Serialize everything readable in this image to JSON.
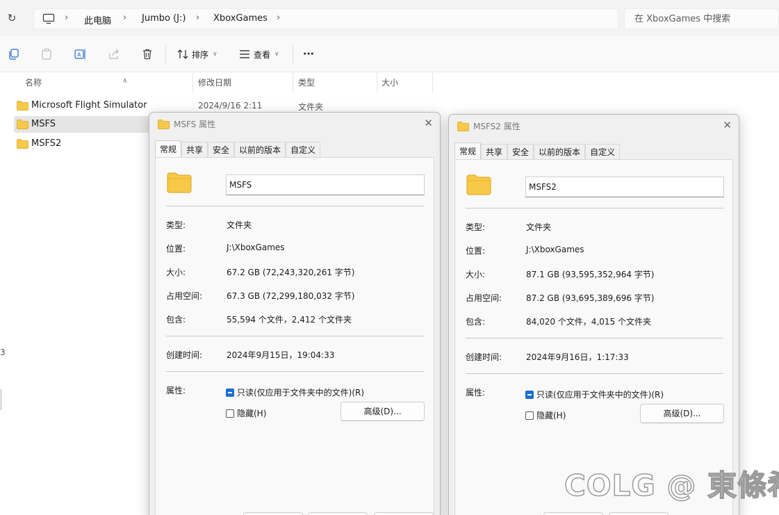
{
  "addressbar": {
    "crumbs": [
      "此电脑",
      "Jumbo (J:)",
      "XboxGames"
    ],
    "search_placeholder": "在 XboxGames 中搜索"
  },
  "toolbar": {
    "sort_label": "排序",
    "view_label": "查看",
    "more_label": "···"
  },
  "columns": {
    "name": "名称",
    "modified": "修改日期",
    "type": "类型",
    "size": "大小"
  },
  "files": [
    {
      "name": "Microsoft Flight Simulator",
      "modified": "2024/9/16 2:11",
      "type": "文件夹"
    },
    {
      "name": "MSFS",
      "modified": "",
      "type": ""
    },
    {
      "name": "MSFS2",
      "modified": "",
      "type": ""
    }
  ],
  "sidebar_edge_glyph": "3",
  "dialogs": [
    {
      "title": "MSFS 属性",
      "tabs": [
        "常规",
        "共享",
        "安全",
        "以前的版本",
        "自定义"
      ],
      "name_value": "MSFS",
      "labels": {
        "type": "类型:",
        "location": "位置:",
        "size": "大小:",
        "size_on_disk": "占用空间:",
        "contains": "包含:",
        "created": "创建时间:",
        "attributes": "属性:"
      },
      "type": "文件夹",
      "location": "J:\\XboxGames",
      "size": "67.2 GB (72,243,320,261 字节)",
      "size_on_disk": "67.3 GB (72,299,180,032 字节)",
      "contains": "55,594 个文件，2,412 个文件夹",
      "created": "2024年9月15日，19:04:33",
      "readonly_label": "只读(仅应用于文件夹中的文件)(R)",
      "hidden_label": "隐藏(H)",
      "advanced_label": "高级(D)..."
    },
    {
      "title": "MSFS2 属性",
      "tabs": [
        "常规",
        "共享",
        "安全",
        "以前的版本",
        "自定义"
      ],
      "name_value": "MSFS2",
      "labels": {
        "type": "类型:",
        "location": "位置:",
        "size": "大小:",
        "size_on_disk": "占用空间:",
        "contains": "包含:",
        "created": "创建时间:",
        "attributes": "属性:"
      },
      "type": "文件夹",
      "location": "J:\\XboxGames",
      "size": "87.1 GB (93,595,352,964 字节)",
      "size_on_disk": "87.2 GB (93,695,389,696 字节)",
      "contains": "84,020 个文件，4,015 个文件夹",
      "created": "2024年9月16日，1:17:33",
      "readonly_label": "只读(仅应用于文件夹中的文件)(R)",
      "hidden_label": "隐藏(H)",
      "advanced_label": "高级(D)..."
    }
  ],
  "watermark": "COLG @ 東條希",
  "colors": {
    "accent": "#1f6fd0",
    "folder": "#f7c948",
    "selection": "#e5e5e5"
  }
}
